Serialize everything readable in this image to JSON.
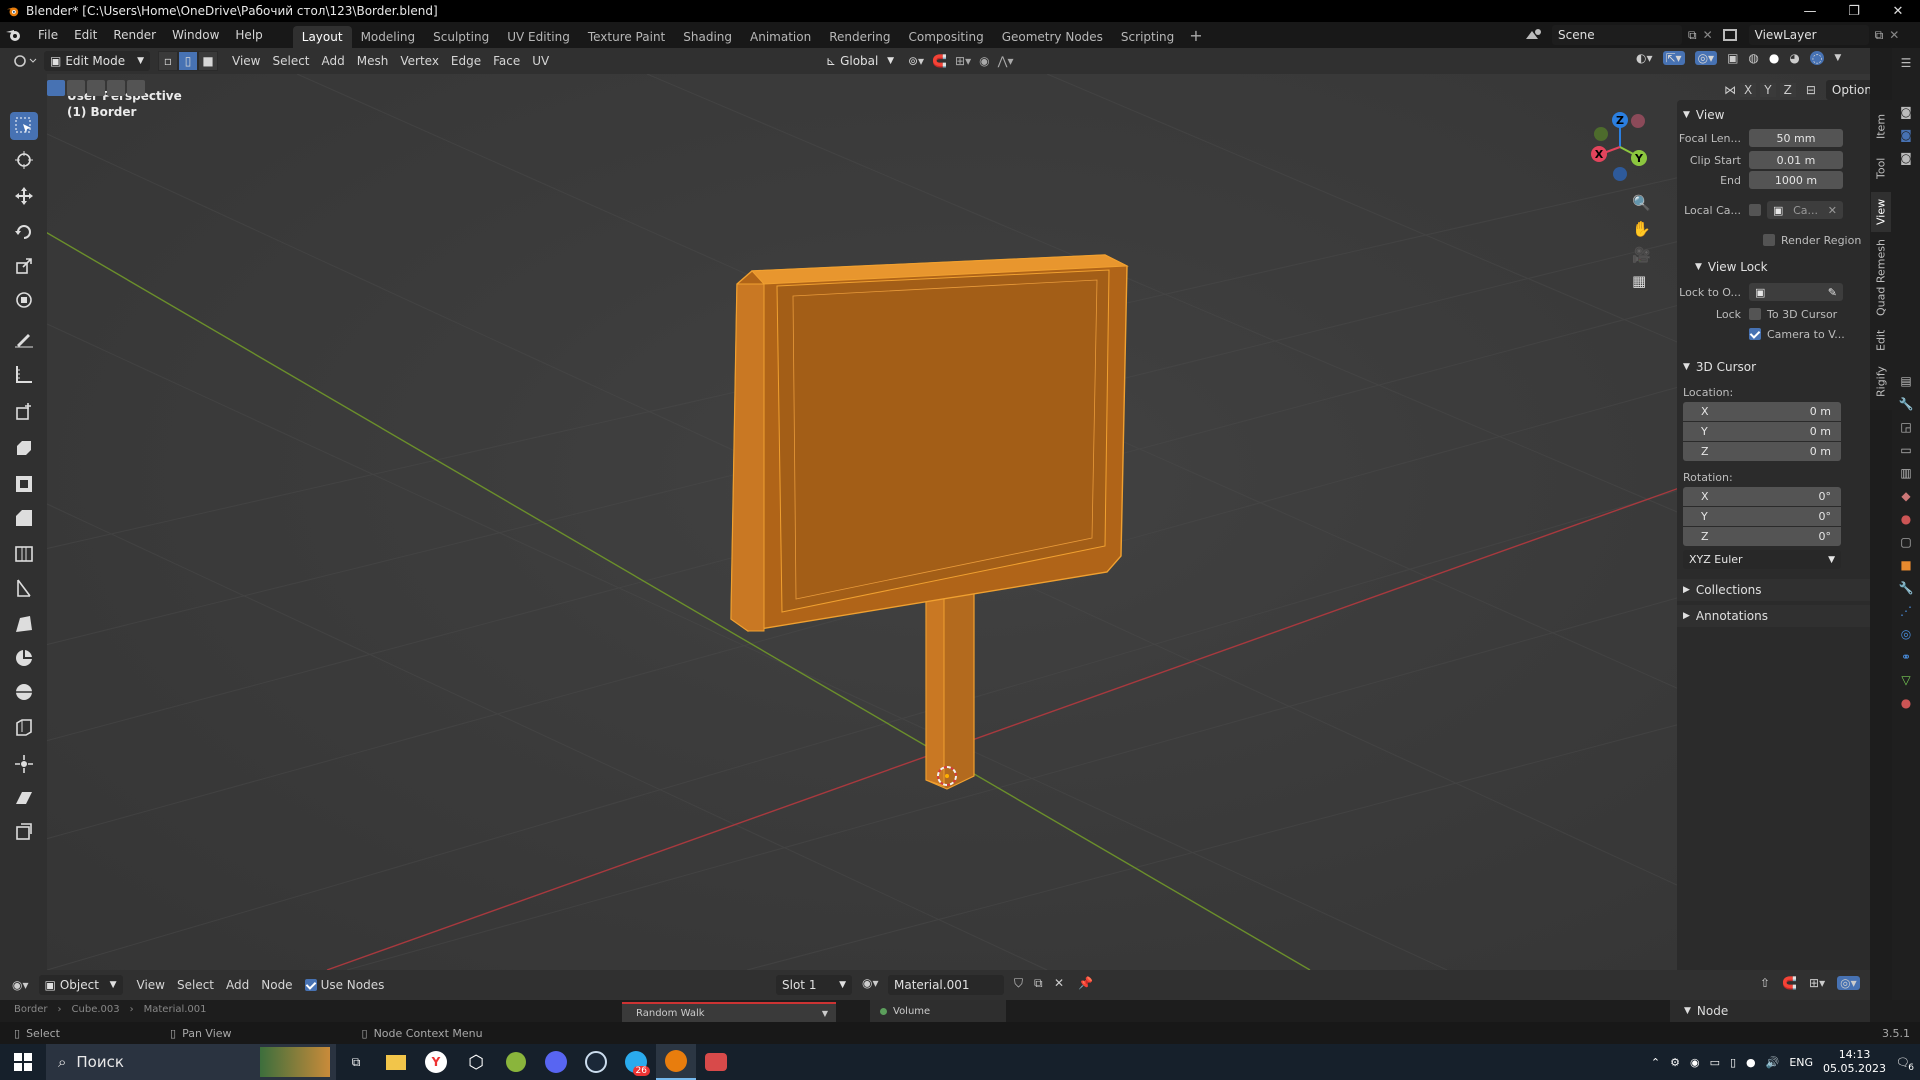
{
  "window": {
    "title": "Blender* [C:\\Users\\Home\\OneDrive\\Рабочий стол\\123\\Border.blend]"
  },
  "menu": [
    "File",
    "Edit",
    "Render",
    "Window",
    "Help"
  ],
  "workspaces": {
    "tabs": [
      "Layout",
      "Modeling",
      "Sculpting",
      "UV Editing",
      "Texture Paint",
      "Shading",
      "Animation",
      "Rendering",
      "Compositing",
      "Geometry Nodes",
      "Scripting"
    ],
    "active": "Layout"
  },
  "scene": {
    "name": "Scene",
    "view_layer": "ViewLayer"
  },
  "viewport_header": {
    "mode": "Edit Mode",
    "menus": [
      "View",
      "Select",
      "Add",
      "Mesh",
      "Vertex",
      "Edge",
      "Face",
      "UV"
    ],
    "transform_orientation": "Global",
    "options_label": "Options",
    "axes": [
      "X",
      "Y",
      "Z"
    ]
  },
  "viewport": {
    "perspective": "User Perspective",
    "object_label": "(1) Border",
    "gizmo_axes": [
      "X",
      "Y",
      "Z"
    ]
  },
  "npanel": {
    "view": {
      "title": "View",
      "focal_label": "Focal Len...",
      "focal_value": "50 mm",
      "clip_start_label": "Clip Start",
      "clip_start_value": "0.01 m",
      "end_label": "End",
      "end_value": "1000 m",
      "local_camera_label": "Local Ca...",
      "local_camera_value": "Ca...",
      "render_region_label": "Render Region"
    },
    "view_lock": {
      "title": "View Lock",
      "lock_to_label": "Lock to O...",
      "lock_label": "Lock",
      "to_cursor_label": "To 3D Cursor",
      "camera_to_view_label": "Camera to V..."
    },
    "cursor": {
      "title": "3D Cursor",
      "location_label": "Location:",
      "location": [
        {
          "axis": "X",
          "value": "0 m"
        },
        {
          "axis": "Y",
          "value": "0 m"
        },
        {
          "axis": "Z",
          "value": "0 m"
        }
      ],
      "rotation_label": "Rotation:",
      "rotation": [
        {
          "axis": "X",
          "value": "0°"
        },
        {
          "axis": "Y",
          "value": "0°"
        },
        {
          "axis": "Z",
          "value": "0°"
        }
      ],
      "rotation_mode": "XYZ Euler"
    },
    "collections_label": "Collections",
    "annotations_label": "Annotations",
    "tabs": [
      "Item",
      "Tool",
      "View",
      "Quad Remesh",
      "Edit",
      "Rigify"
    ]
  },
  "bottom_editor": {
    "type": "Object",
    "menus": [
      "View",
      "Select",
      "Add",
      "Node"
    ],
    "use_nodes_label": "Use Nodes",
    "slot": "Slot 1",
    "material": "Material.001",
    "node_panel_label": "Node",
    "breadcrumb": [
      "Border",
      "Cube.003",
      "Material.001"
    ],
    "node_subsurface": "Random Walk",
    "node_volume": "Volume"
  },
  "statusbar": {
    "select": "Select",
    "pan_view": "Pan View",
    "node_context": "Node Context Menu",
    "version": "3.5.1"
  },
  "taskbar": {
    "search_placeholder": "Поиск",
    "language": "ENG",
    "time": "14:13",
    "date": "05.05.2023",
    "telegram_badge": "26",
    "notifications": "6"
  },
  "colors": {
    "accent": "#4772b3",
    "object_orange": "#d88a2e",
    "x_axis": "#e2445c",
    "y_axis": "#8cc63f",
    "z_axis": "#2b7fe0"
  }
}
